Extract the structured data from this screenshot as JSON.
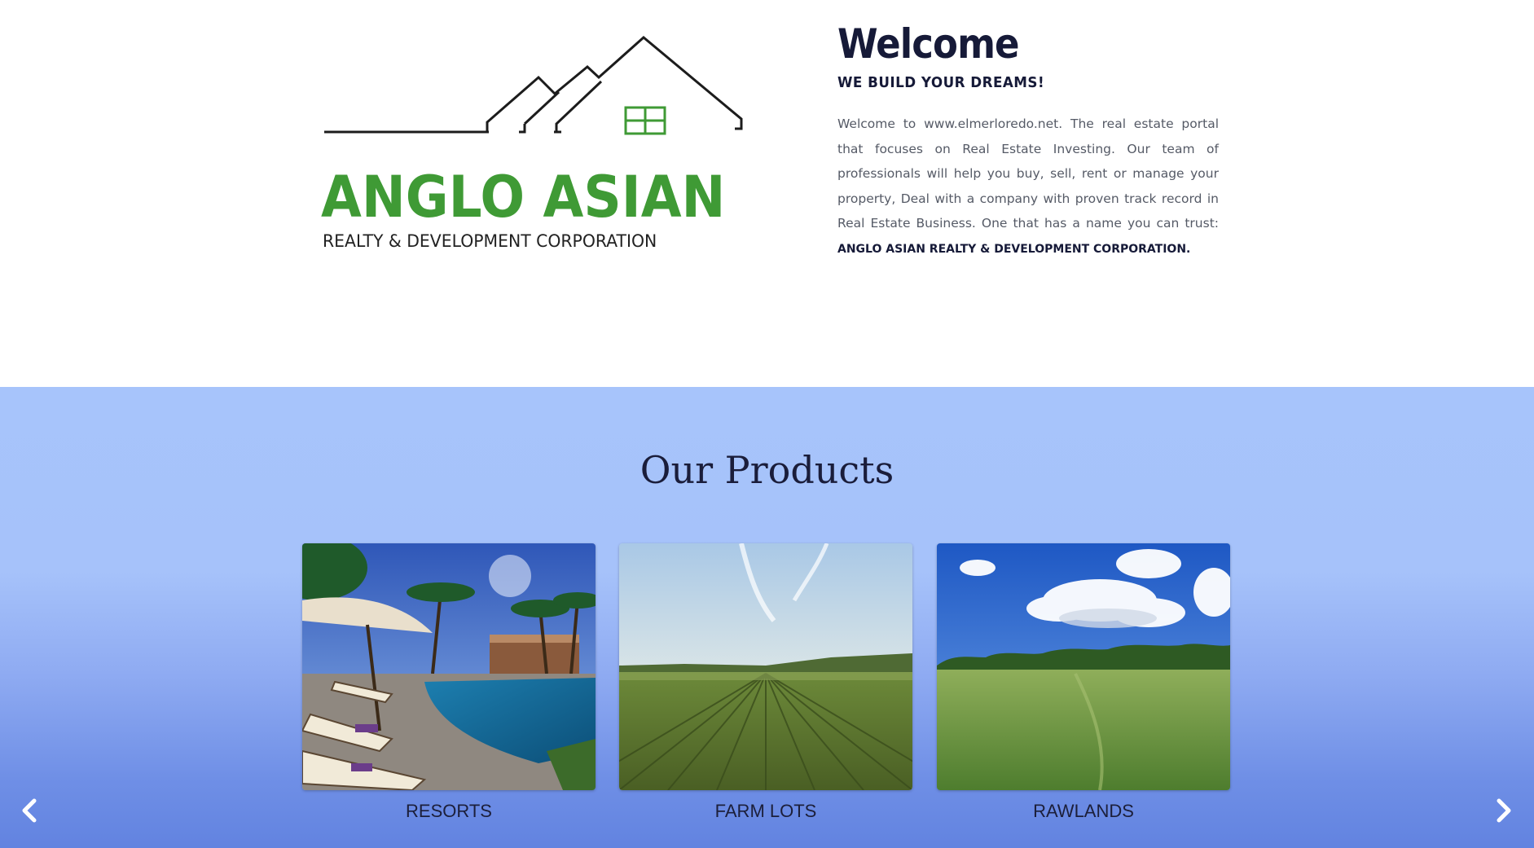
{
  "logo": {
    "brand": "ANGLO ASIAN",
    "tagline": "REALTY & DEVELOPMENT CORPORATION"
  },
  "welcome": {
    "title": "Welcome",
    "subtitle": "WE BUILD YOUR DREAMS!",
    "body": "Welcome to www.elmerloredo.net. The real estate portal that focuses on Real Estate Investing. Our team of professionals will help you buy, sell, rent or manage your property, Deal with a company with proven track record in Real Estate Business. One that has a name you can trust:",
    "company_name": "ANGLO ASIAN REALTY & DEVELOPMENT CORPORATION."
  },
  "products": {
    "title": "Our Products",
    "items": [
      {
        "label": "RESORTS"
      },
      {
        "label": "FARM LOTS"
      },
      {
        "label": "RAWLANDS"
      }
    ]
  },
  "navigation": {
    "prev_icon": "chevron-left-icon",
    "next_icon": "chevron-right-icon"
  },
  "colors": {
    "brand_green": "#3f9a35",
    "heading_navy": "#161a38",
    "section_blue": "#a7c4fb"
  }
}
